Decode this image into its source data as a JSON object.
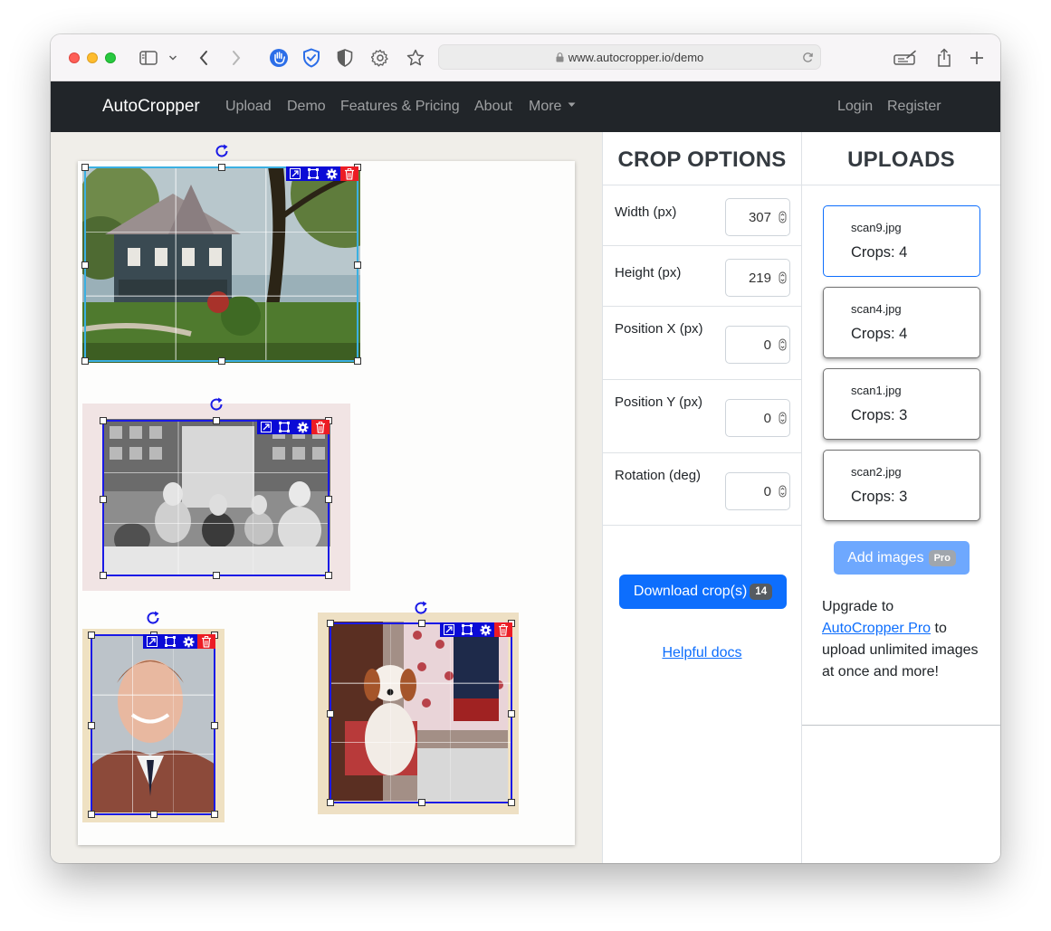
{
  "browser": {
    "url": "www.autocropper.io/demo"
  },
  "navbar": {
    "brand": "AutoCropper",
    "links": [
      "Upload",
      "Demo",
      "Features & Pricing",
      "About",
      "More"
    ],
    "right_links": [
      "Login",
      "Register"
    ]
  },
  "crop_options": {
    "title": "CROP OPTIONS",
    "fields": [
      {
        "label": "Width (px)",
        "value": "307"
      },
      {
        "label": "Height (px)",
        "value": "219"
      },
      {
        "label": "Position X (px)",
        "value": "0"
      },
      {
        "label": "Position Y (px)",
        "value": "0"
      },
      {
        "label": "Rotation (deg)",
        "value": "0"
      }
    ],
    "download_label": "Download crop(s)",
    "download_count": "14",
    "docs_link": "Helpful docs"
  },
  "uploads": {
    "title": "UPLOADS",
    "files": [
      {
        "name": "scan9.jpg",
        "crops": "Crops: 4",
        "selected": true
      },
      {
        "name": "scan4.jpg",
        "crops": "Crops: 4",
        "selected": false
      },
      {
        "name": "scan1.jpg",
        "crops": "Crops: 3",
        "selected": false
      },
      {
        "name": "scan2.jpg",
        "crops": "Crops: 3",
        "selected": false
      }
    ],
    "add_images_label": "Add images",
    "add_images_badge": "Pro",
    "upgrade_prefix": "Upgrade to",
    "upgrade_link": "AutoCropper Pro",
    "upgrade_suffix": "to upload unlimited images at once and more!"
  },
  "canvas": {
    "photos": [
      "house-photo",
      "family-dinner-photo",
      "boy-portrait-photo",
      "dog-photo"
    ],
    "crop_tool_icons": [
      "expand-icon",
      "fit-icon",
      "settings-icon",
      "delete-icon"
    ]
  },
  "colors": {
    "navbar_bg": "#212529",
    "primary": "#0d6efd",
    "crop_border": "#1a1ae6",
    "active_crop_border": "#3ab0e2",
    "delete_red": "#ec1c24"
  }
}
